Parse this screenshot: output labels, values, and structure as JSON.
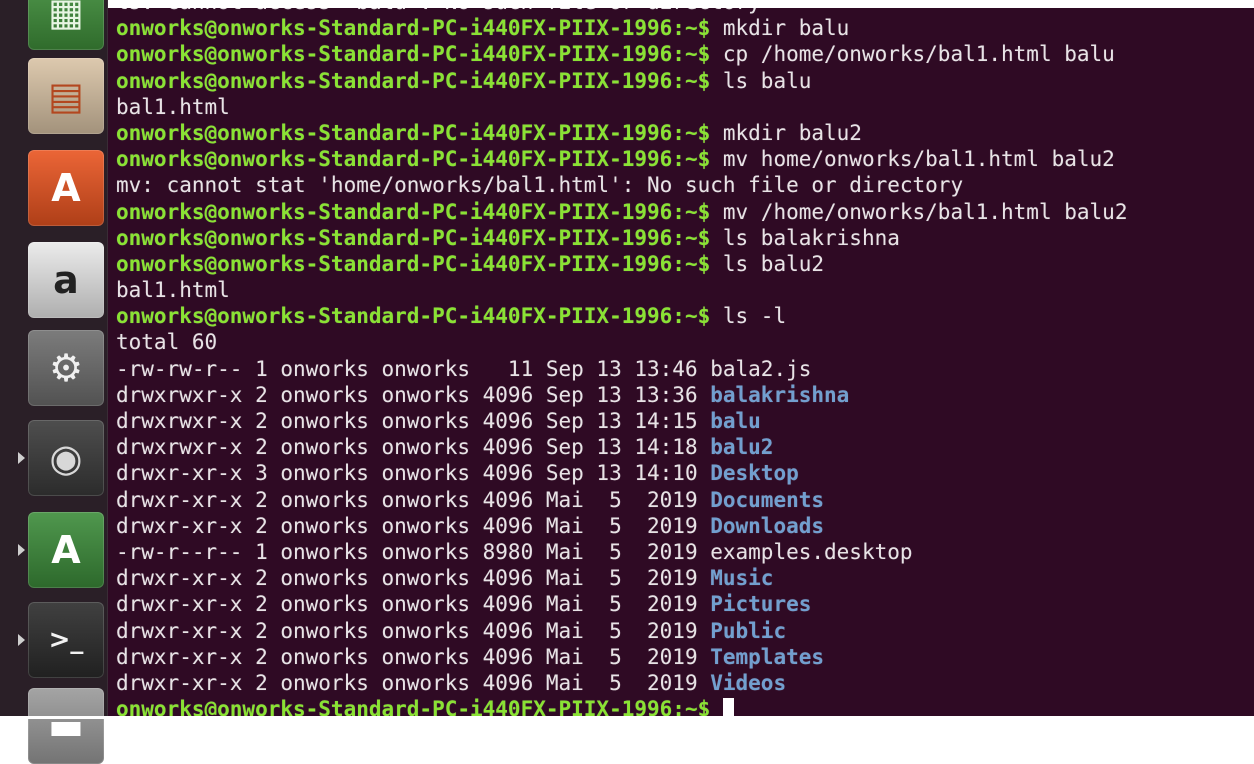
{
  "launcher": {
    "items": [
      {
        "name": "libreoffice-calc-icon",
        "glyph": "▦",
        "bg": "#3f8f3a",
        "fg": "#e8f5e3",
        "running": false
      },
      {
        "name": "libreoffice-impress-icon",
        "glyph": "▤",
        "bg": "#d9c3a5",
        "fg": "#b3471f",
        "running": false
      },
      {
        "name": "ubuntu-software-center-icon",
        "glyph": "A",
        "bg": "#e95420",
        "fg": "#ffffff",
        "running": false
      },
      {
        "name": "amazon-icon",
        "glyph": "a",
        "bg": "#e9e9e9",
        "fg": "#222222",
        "running": false
      },
      {
        "name": "system-settings-icon",
        "glyph": "⚙",
        "bg": "#6d6d6d",
        "fg": "#f0f0f0",
        "running": false
      },
      {
        "name": "disk-utility-icon",
        "glyph": "◉",
        "bg": "#3a3a3a",
        "fg": "#d8d8d8",
        "running": true
      },
      {
        "name": "software-updater-icon",
        "glyph": "A",
        "bg": "#3c8c3a",
        "fg": "#ffffff",
        "running": true
      },
      {
        "name": "terminal-icon",
        "glyph": ">_",
        "bg": "#2b2b2b",
        "fg": "#f2f2f2",
        "running": true
      },
      {
        "name": "save-drive-icon",
        "glyph": "▬",
        "bg": "#9a9a9a",
        "fg": "#ffffff",
        "running": false
      }
    ]
  },
  "terminal": {
    "prompt_text": "onworks@onworks-Standard-PC-i440FX-PIIX-1996:~$",
    "lines": [
      {
        "type": "output",
        "text": "ls: cannot access 'balu': No such file or directory"
      },
      {
        "type": "prompt",
        "cmd": " mkdir balu"
      },
      {
        "type": "prompt",
        "cmd": " cp /home/onworks/bal1.html balu"
      },
      {
        "type": "prompt",
        "cmd": " ls balu"
      },
      {
        "type": "output",
        "text": "bal1.html"
      },
      {
        "type": "prompt",
        "cmd": " mkdir balu2"
      },
      {
        "type": "prompt",
        "cmd": " mv home/onworks/bal1.html balu2"
      },
      {
        "type": "output",
        "text": "mv: cannot stat 'home/onworks/bal1.html': No such file or directory"
      },
      {
        "type": "prompt",
        "cmd": " mv /home/onworks/bal1.html balu2"
      },
      {
        "type": "prompt",
        "cmd": " ls balakrishna"
      },
      {
        "type": "prompt",
        "cmd": " ls balu2"
      },
      {
        "type": "output",
        "text": "bal1.html"
      },
      {
        "type": "prompt",
        "cmd": " ls -l"
      },
      {
        "type": "output",
        "text": "total 60"
      },
      {
        "type": "listing",
        "meta": "-rw-rw-r-- 1 onworks onworks   11 Sep 13 13:46 ",
        "name": "bala2.js",
        "is_dir": false
      },
      {
        "type": "listing",
        "meta": "drwxrwxr-x 2 onworks onworks 4096 Sep 13 13:36 ",
        "name": "balakrishna",
        "is_dir": true
      },
      {
        "type": "listing",
        "meta": "drwxrwxr-x 2 onworks onworks 4096 Sep 13 14:15 ",
        "name": "balu",
        "is_dir": true
      },
      {
        "type": "listing",
        "meta": "drwxrwxr-x 2 onworks onworks 4096 Sep 13 14:18 ",
        "name": "balu2",
        "is_dir": true
      },
      {
        "type": "listing",
        "meta": "drwxr-xr-x 3 onworks onworks 4096 Sep 13 14:10 ",
        "name": "Desktop",
        "is_dir": true
      },
      {
        "type": "listing",
        "meta": "drwxr-xr-x 2 onworks onworks 4096 Mai  5  2019 ",
        "name": "Documents",
        "is_dir": true
      },
      {
        "type": "listing",
        "meta": "drwxr-xr-x 2 onworks onworks 4096 Mai  5  2019 ",
        "name": "Downloads",
        "is_dir": true
      },
      {
        "type": "listing",
        "meta": "-rw-r--r-- 1 onworks onworks 8980 Mai  5  2019 ",
        "name": "examples.desktop",
        "is_dir": false
      },
      {
        "type": "listing",
        "meta": "drwxr-xr-x 2 onworks onworks 4096 Mai  5  2019 ",
        "name": "Music",
        "is_dir": true
      },
      {
        "type": "listing",
        "meta": "drwxr-xr-x 2 onworks onworks 4096 Mai  5  2019 ",
        "name": "Pictures",
        "is_dir": true
      },
      {
        "type": "listing",
        "meta": "drwxr-xr-x 2 onworks onworks 4096 Mai  5  2019 ",
        "name": "Public",
        "is_dir": true
      },
      {
        "type": "listing",
        "meta": "drwxr-xr-x 2 onworks onworks 4096 Mai  5  2019 ",
        "name": "Templates",
        "is_dir": true
      },
      {
        "type": "listing",
        "meta": "drwxr-xr-x 2 onworks onworks 4096 Mai  5  2019 ",
        "name": "Videos",
        "is_dir": true
      },
      {
        "type": "prompt",
        "cmd": " ",
        "cursor": true
      }
    ]
  },
  "colors": {
    "terminal_bg": "#2f0a24",
    "prompt": "#8ae234",
    "directory": "#729fcf",
    "text": "#e8e3e6"
  }
}
